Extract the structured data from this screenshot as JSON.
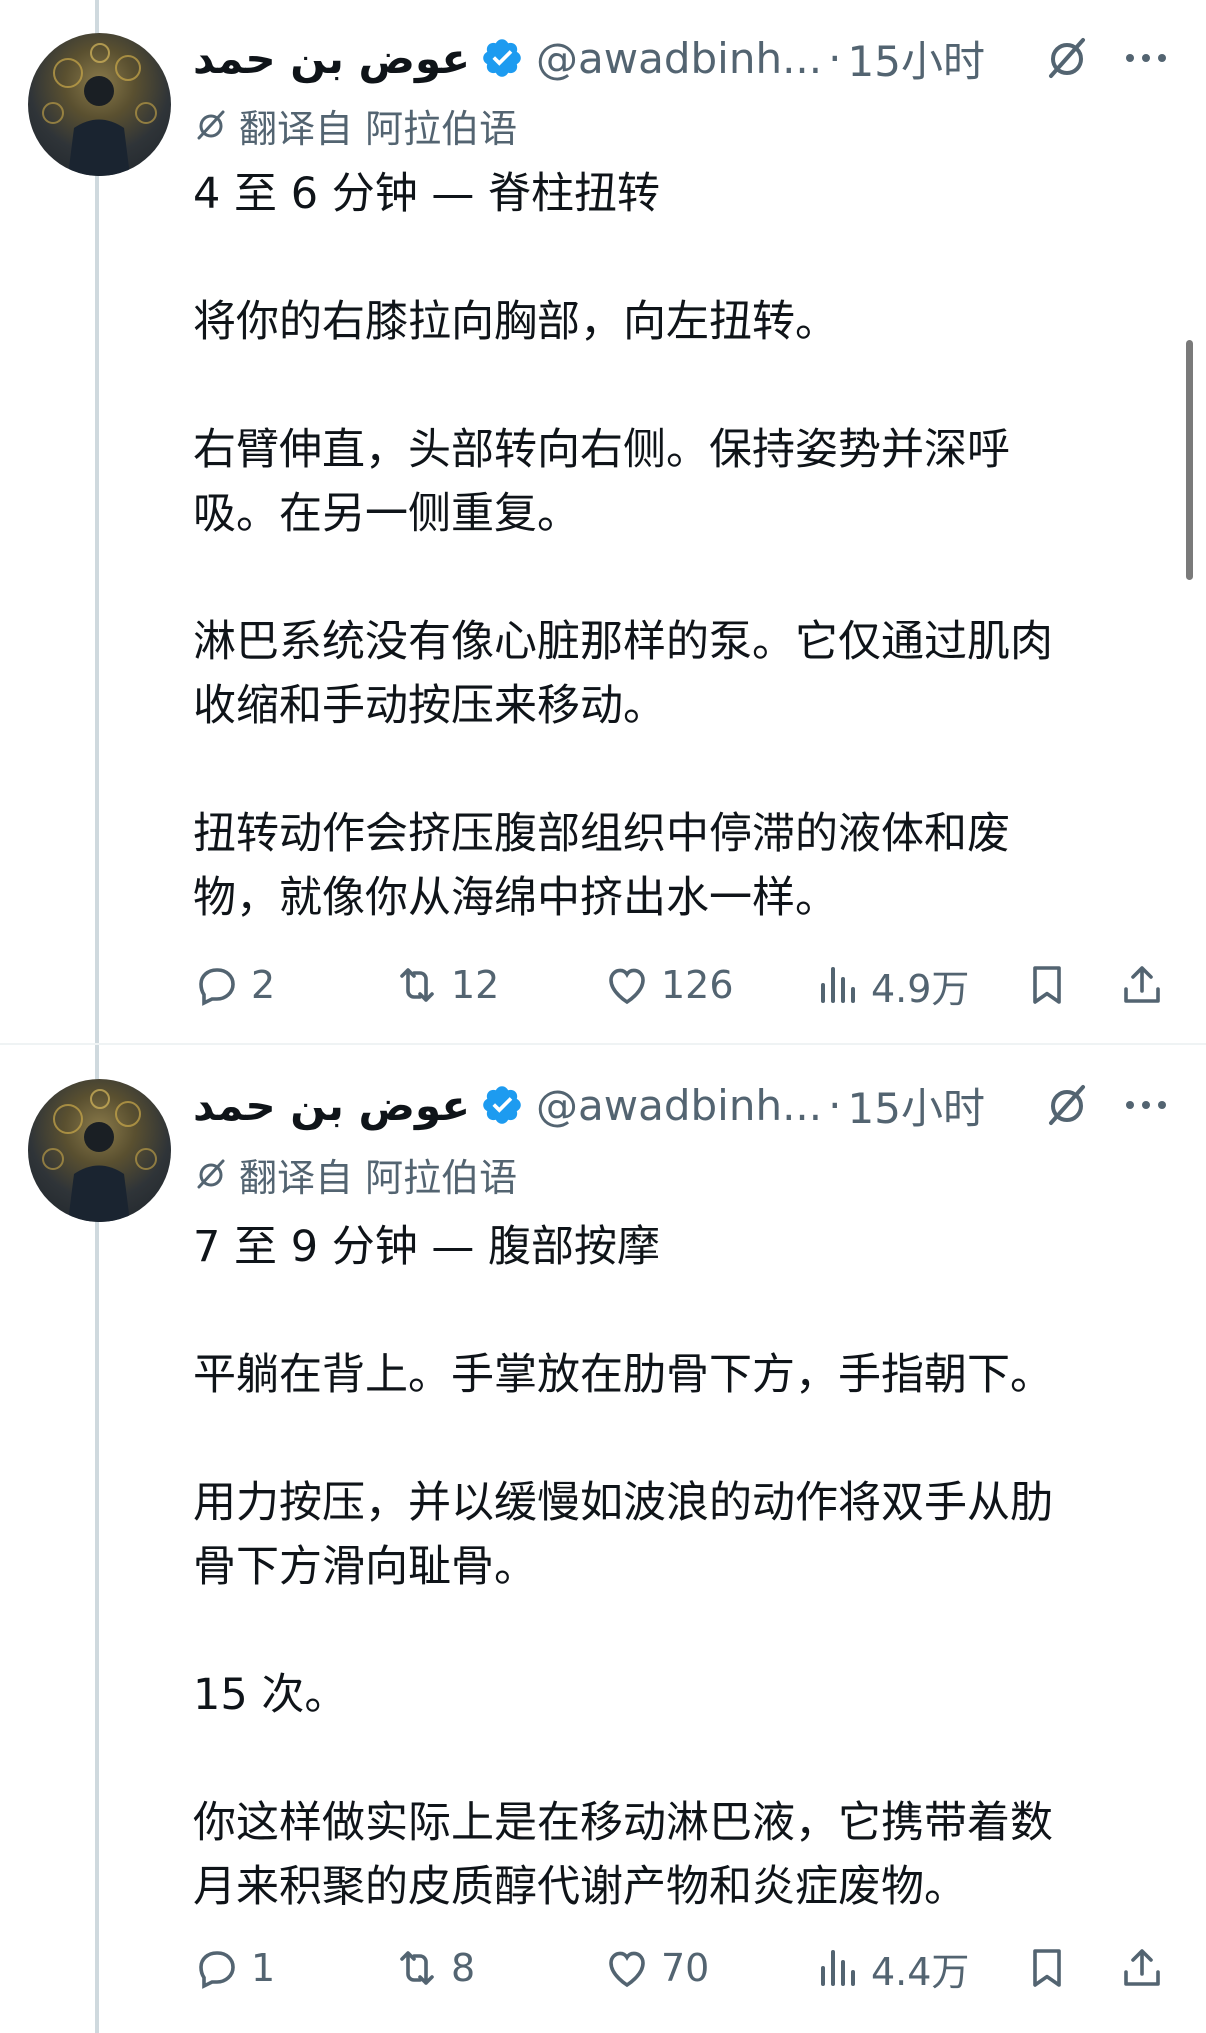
{
  "tweets": [
    {
      "author": {
        "display_name": "عوض بن حمد",
        "handle": "@awadbinh...",
        "time": "15小时"
      },
      "translation_note": "翻译自 阿拉伯语",
      "paragraphs": [
        "4 至 6 分钟 — 脊柱扭转",
        "将你的右膝拉向胸部，向左扭转。",
        "右臂伸直，头部转向右侧。保持姿势并深呼\n吸。在另一侧重复。",
        "淋巴系统没有像心脏那样的泵。它仅通过肌肉\n收缩和手动按压来移动。",
        "扭转动作会挤压腹部组织中停滞的液体和废\n物，就像你从海绵中挤出水一样。"
      ],
      "stats": {
        "replies": "2",
        "reposts": "12",
        "likes": "126",
        "views": "4.9万"
      }
    },
    {
      "author": {
        "display_name": "عوض بن حمد",
        "handle": "@awadbinh...",
        "time": "15小时"
      },
      "translation_note": "翻译自 阿拉伯语",
      "paragraphs": [
        "7 至 9 分钟 — 腹部按摩",
        "平躺在背上。手掌放在肋骨下方，手指朝下。",
        "用力按压，并以缓慢如波浪的动作将双手从肋\n骨下方滑向耻骨。",
        "15 次。",
        "你这样做实际上是在移动淋巴液，它携带着数\n月来积聚的皮质醇代谢产物和炎症废物。"
      ],
      "stats": {
        "replies": "1",
        "reposts": "8",
        "likes": "70",
        "views": "4.4万"
      }
    }
  ],
  "colors": {
    "verified": "#1d9bf0",
    "secondary_text": "#536471",
    "thread_line": "#cfd9de"
  }
}
